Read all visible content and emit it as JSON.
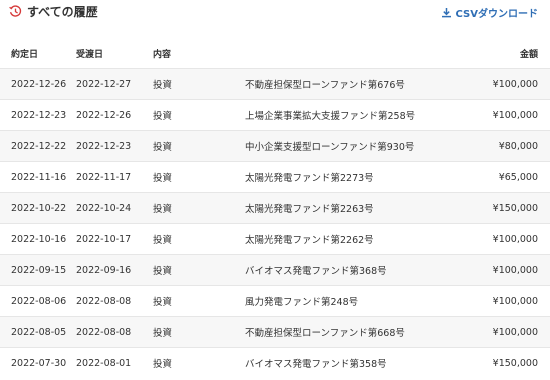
{
  "header": {
    "title": "すべての履歴",
    "csv_label": "CSVダウンロード",
    "accent_color": "#2f6eb5",
    "title_icon_color": "#d63a3a"
  },
  "table": {
    "columns": [
      "約定日",
      "受渡日",
      "内容",
      "",
      "金額"
    ],
    "rows": [
      {
        "trade": "2022-12-26",
        "settle": "2022-12-27",
        "type": "投資",
        "name": "不動産担保型ローンファンド第676号",
        "amount": "¥100,000"
      },
      {
        "trade": "2022-12-23",
        "settle": "2022-12-26",
        "type": "投資",
        "name": "上場企業事業拡大支援ファンド第258号",
        "amount": "¥100,000"
      },
      {
        "trade": "2022-12-22",
        "settle": "2022-12-23",
        "type": "投資",
        "name": "中小企業支援型ローンファンド第930号",
        "amount": "¥80,000"
      },
      {
        "trade": "2022-11-16",
        "settle": "2022-11-17",
        "type": "投資",
        "name": "太陽光発電ファンド第2273号",
        "amount": "¥65,000"
      },
      {
        "trade": "2022-10-22",
        "settle": "2022-10-24",
        "type": "投資",
        "name": "太陽光発電ファンド第2263号",
        "amount": "¥150,000"
      },
      {
        "trade": "2022-10-16",
        "settle": "2022-10-17",
        "type": "投資",
        "name": "太陽光発電ファンド第2262号",
        "amount": "¥100,000"
      },
      {
        "trade": "2022-09-15",
        "settle": "2022-09-16",
        "type": "投資",
        "name": "バイオマス発電ファンド第368号",
        "amount": "¥100,000"
      },
      {
        "trade": "2022-08-06",
        "settle": "2022-08-08",
        "type": "投資",
        "name": "風力発電ファンド第248号",
        "amount": "¥100,000"
      },
      {
        "trade": "2022-08-05",
        "settle": "2022-08-08",
        "type": "投資",
        "name": "不動産担保型ローンファンド第668号",
        "amount": "¥100,000"
      },
      {
        "trade": "2022-07-30",
        "settle": "2022-08-01",
        "type": "投資",
        "name": "バイオマス発電ファンド第358号",
        "amount": "¥150,000"
      }
    ]
  }
}
